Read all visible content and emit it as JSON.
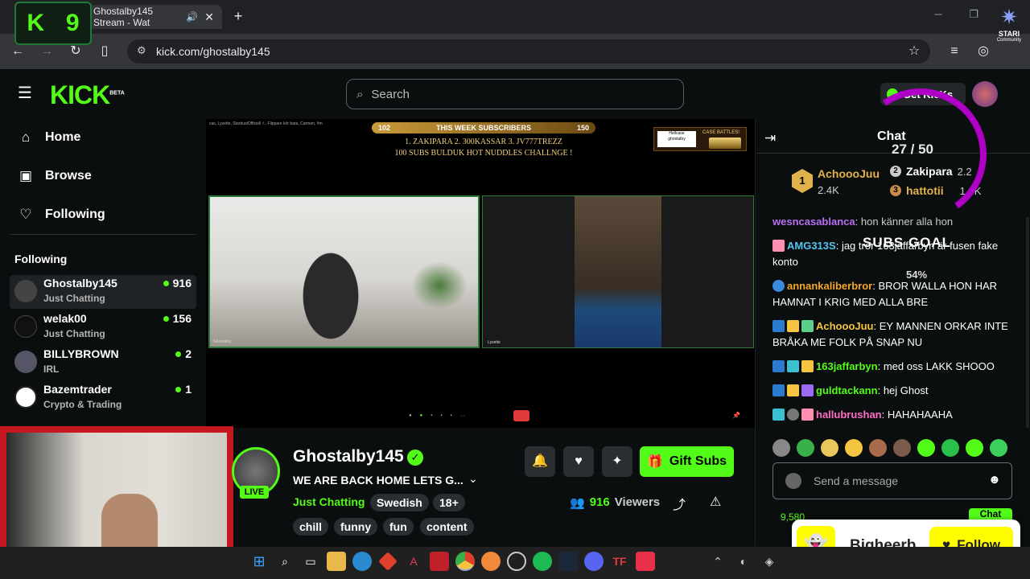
{
  "browser": {
    "tab_title": "Ghostalby145 Stream - Wat",
    "url": "kick.com/ghostalby145",
    "overlay_counter_letter": "K",
    "overlay_counter_value": "9",
    "stari_label": "STARI",
    "stari_sub": "Community"
  },
  "header": {
    "logo": "KICK",
    "logo_badge": "BETA",
    "search_placeholder": "Search",
    "get_kicks_label": "Get KicKs"
  },
  "sidebar": {
    "nav": [
      {
        "label": "Home",
        "icon": "home-icon"
      },
      {
        "label": "Browse",
        "icon": "browse-icon"
      },
      {
        "label": "Following",
        "icon": "heart-icon"
      }
    ],
    "following_header": "Following",
    "following": [
      {
        "name": "Ghostalby145",
        "category": "Just Chatting",
        "viewers": "916"
      },
      {
        "name": "welak00",
        "category": "Just Chatting",
        "viewers": "156"
      },
      {
        "name": "BILLYBROWN",
        "category": "IRL",
        "viewers": "2"
      },
      {
        "name": "Bazemtrader",
        "category": "Crypto & Trading",
        "viewers": "1"
      }
    ]
  },
  "stream_overlay": {
    "subs_left_count": "102",
    "subs_title": "THIS WEEK SUBSCRIBERS",
    "subs_right_count": "150",
    "subs_line1": "1. ZAKIPARA   2. 300KASSAR   3.  JV777TREZZ",
    "subs_line2": "100 SUBS BULDUK HOT NUDDLES CHALLNGE !",
    "top_chat_snippet": "cas, Lysette, StardustOfficiell :\\ , Flippare kör bara, Carmen, #m",
    "cam1_label": "Ghostalby",
    "cam2_label": "Lysette",
    "sponsor_label": "Hellcase",
    "sponsor_code": "ghostalby",
    "sponsor_sub": "CASE BATTLES!"
  },
  "stream_info": {
    "streamer": "Ghostalby145",
    "title": "WE ARE BACK HOME LETS G...",
    "category": "Just Chatting",
    "tags_row1": [
      "Swedish",
      "18+"
    ],
    "tags_row2": [
      "chill",
      "funny",
      "fun",
      "content"
    ],
    "live_label": "LIVE",
    "gift_subs_label": "Gift Subs",
    "viewers_count": "916",
    "viewers_label": "Viewers"
  },
  "chat": {
    "title": "Chat",
    "pinned": [
      {
        "rank": "1",
        "name": "AchoooJuu",
        "value": "2.4K"
      },
      {
        "rank": "2",
        "name": "Zakipara",
        "value": "2.2"
      },
      {
        "rank": "3",
        "name": "hattotii",
        "value": "1.3K"
      }
    ],
    "goal_count": "27 / 50",
    "goal_label": "SUBS GOAL",
    "goal_percent": "54%",
    "messages": [
      {
        "user": "wesncasablanca",
        "color": "#b86ef5",
        "text": "hon känner alla hon"
      },
      {
        "user": "AMG313S",
        "color": "#53c6f0",
        "text": "jag tror 163jaffarbyn är fusen fake konto"
      },
      {
        "user": "annankaliberbror",
        "color": "#f5a623",
        "text": "BROR WALLA HON HAR HAMNAT I KRIG MED ALLA BRE"
      },
      {
        "user": "AchoooJuu",
        "color": "#f5c542",
        "text": "EY MANNEN ORKAR INTE BRÅKA ME FOLK PÅ SNAP NU"
      },
      {
        "user": "163jaffarbyn",
        "color": "#53fc18",
        "text": "med oss LAKK SHOOO"
      },
      {
        "user": "guldtackann",
        "color": "#53fc18",
        "text": "hej Ghost"
      },
      {
        "user": "hallubrushan",
        "color": "#ff6ec7",
        "text": "HAHAHAAHA"
      }
    ],
    "input_placeholder": "Send a message",
    "points": "9,580",
    "send_label": "Chat"
  },
  "snap_popup": {
    "name": "Bigheerb",
    "follow_label": "Follow"
  },
  "colors": {
    "accent": "#53fc18",
    "background": "#0b0e0f",
    "goal_ring": "#b000c8",
    "snap_yellow": "#fffc00"
  }
}
